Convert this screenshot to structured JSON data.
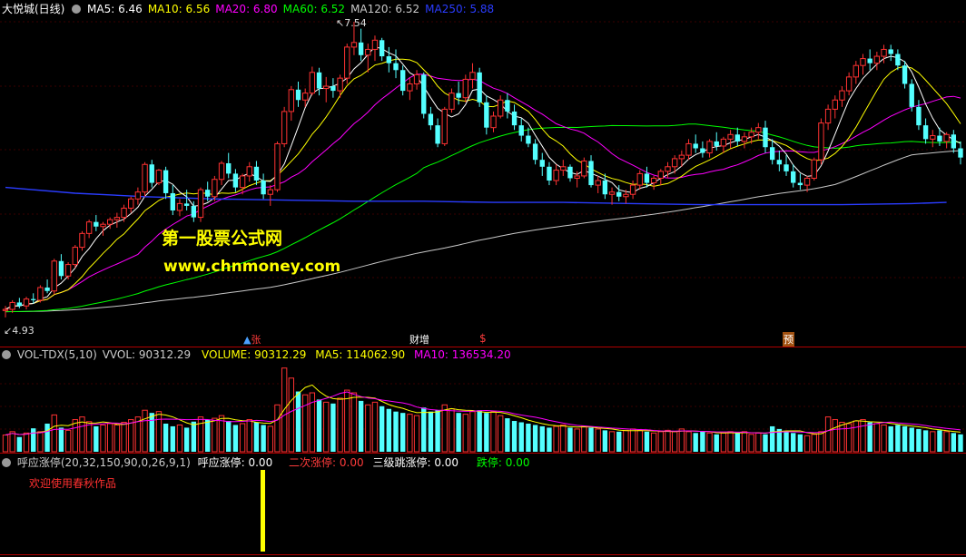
{
  "main_panel": {
    "stock_title": "大悦城(日线)",
    "indicators": [
      {
        "label": "MA5:",
        "value": "6.46",
        "color": "#ffffff"
      },
      {
        "label": "MA10:",
        "value": "6.56",
        "color": "#ffff00"
      },
      {
        "label": "MA20:",
        "value": "6.80",
        "color": "#ff00ff"
      },
      {
        "label": "MA60:",
        "value": "6.52",
        "color": "#00ff00"
      },
      {
        "label": "MA120:",
        "value": "6.52",
        "color": "#c8c8c8"
      },
      {
        "label": "MA250:",
        "value": "5.88",
        "color": "#2a3cff"
      }
    ],
    "high_label": "7.54",
    "low_label": "4.93",
    "watermark_line1": "第一股票公式网",
    "watermark_line2": "www.chnmoney.com",
    "markers": [
      {
        "text": "张",
        "color": "#ff3b3b"
      },
      {
        "text": "财增",
        "color": "#ffffff"
      },
      {
        "text": "$",
        "color": "#ff3b3b"
      },
      {
        "text": "预",
        "color": "#ffffff"
      }
    ]
  },
  "vol_panel": {
    "title": "VOL-TDX(5,10)",
    "vvol_label": "VVOL:",
    "vvol_value": "90312.29",
    "volume_label": "VOLUME:",
    "volume_value": "90312.29",
    "ma5_label": "MA5:",
    "ma5_value": "114062.90",
    "ma10_label": "MA10:",
    "ma10_value": "136534.20"
  },
  "ind_panel": {
    "title": "呼应涨停(20,32,150,90,0,26,9,1)",
    "items": [
      {
        "label": "呼应涨停:",
        "value": "0.00",
        "color": "#ffffff"
      },
      {
        "label": "二次涨停:",
        "value": "0.00",
        "color": "#ff3b3b"
      },
      {
        "label": "三级跳涨停:",
        "value": "0.00",
        "color": "#ffffff"
      },
      {
        "label": "跌停:",
        "value": "0.00",
        "color": "#00ff00"
      }
    ],
    "welcome_text": "欢迎使用春秋作品"
  },
  "chart_data": {
    "type": "candlestick",
    "price_range": [
      4.93,
      7.54
    ],
    "ma_colors": {
      "ma5": "#ffffff",
      "ma10": "#ffff00",
      "ma20": "#ff00ff",
      "ma60": "#00ff00",
      "ma120": "#c8c8c8",
      "ma250": "#2a3cff"
    },
    "candles": [
      [
        5.03,
        5.07,
        4.97,
        5.04
      ],
      [
        5.04,
        5.12,
        5.01,
        5.1
      ],
      [
        5.1,
        5.14,
        5.05,
        5.07
      ],
      [
        5.07,
        5.15,
        5.04,
        5.13
      ],
      [
        5.13,
        5.18,
        5.09,
        5.12
      ],
      [
        5.12,
        5.25,
        5.1,
        5.23
      ],
      [
        5.23,
        5.3,
        5.18,
        5.2
      ],
      [
        5.2,
        5.48,
        5.17,
        5.46
      ],
      [
        5.46,
        5.52,
        5.3,
        5.33
      ],
      [
        5.33,
        5.45,
        5.3,
        5.43
      ],
      [
        5.43,
        5.6,
        5.4,
        5.58
      ],
      [
        5.58,
        5.72,
        5.55,
        5.7
      ],
      [
        5.7,
        5.82,
        5.66,
        5.8
      ],
      [
        5.8,
        5.86,
        5.72,
        5.76
      ],
      [
        5.76,
        5.8,
        5.68,
        5.78
      ],
      [
        5.78,
        5.84,
        5.74,
        5.82
      ],
      [
        5.82,
        5.88,
        5.75,
        5.84
      ],
      [
        5.84,
        5.95,
        5.8,
        5.92
      ],
      [
        5.92,
        6.02,
        5.88,
        6.0
      ],
      [
        6.0,
        6.1,
        5.95,
        6.06
      ],
      [
        6.06,
        6.32,
        6.02,
        6.3
      ],
      [
        6.3,
        6.34,
        6.1,
        6.14
      ],
      [
        6.14,
        6.26,
        6.12,
        6.25
      ],
      [
        6.25,
        6.28,
        6.0,
        6.05
      ],
      [
        6.05,
        6.12,
        5.86,
        5.9
      ],
      [
        5.9,
        6.0,
        5.85,
        5.96
      ],
      [
        5.96,
        6.08,
        5.9,
        5.94
      ],
      [
        5.94,
        5.98,
        5.8,
        5.84
      ],
      [
        5.84,
        6.1,
        5.8,
        6.08
      ],
      [
        6.08,
        6.15,
        5.98,
        6.02
      ],
      [
        6.02,
        6.2,
        5.98,
        6.17
      ],
      [
        6.17,
        6.33,
        6.12,
        6.31
      ],
      [
        6.31,
        6.4,
        6.18,
        6.22
      ],
      [
        6.22,
        6.26,
        6.06,
        6.1
      ],
      [
        6.1,
        6.22,
        6.04,
        6.2
      ],
      [
        6.2,
        6.32,
        6.15,
        6.28
      ],
      [
        6.28,
        6.33,
        6.12,
        6.16
      ],
      [
        6.16,
        6.22,
        6.0,
        6.04
      ],
      [
        6.04,
        6.12,
        5.94,
        6.08
      ],
      [
        6.08,
        6.5,
        6.06,
        6.48
      ],
      [
        6.48,
        6.8,
        6.45,
        6.76
      ],
      [
        6.76,
        6.98,
        6.68,
        6.95
      ],
      [
        6.95,
        7.02,
        6.8,
        6.86
      ],
      [
        6.86,
        6.96,
        6.8,
        6.92
      ],
      [
        6.92,
        7.15,
        6.9,
        7.1
      ],
      [
        7.1,
        7.14,
        6.9,
        6.96
      ],
      [
        6.96,
        7.06,
        6.84,
        6.98
      ],
      [
        6.98,
        7.05,
        6.88,
        6.94
      ],
      [
        6.94,
        7.08,
        6.88,
        7.05
      ],
      [
        7.05,
        7.35,
        7.0,
        7.32
      ],
      [
        7.32,
        7.54,
        7.25,
        7.36
      ],
      [
        7.36,
        7.48,
        7.2,
        7.25
      ],
      [
        7.25,
        7.35,
        7.1,
        7.3
      ],
      [
        7.3,
        7.42,
        7.2,
        7.38
      ],
      [
        7.38,
        7.4,
        7.2,
        7.24
      ],
      [
        7.24,
        7.32,
        7.1,
        7.18
      ],
      [
        7.18,
        7.3,
        7.05,
        7.12
      ],
      [
        7.12,
        7.16,
        6.9,
        6.94
      ],
      [
        6.94,
        7.05,
        6.86,
        7.0
      ],
      [
        7.0,
        7.12,
        6.95,
        7.08
      ],
      [
        7.08,
        7.1,
        6.7,
        6.74
      ],
      [
        6.74,
        6.8,
        6.6,
        6.64
      ],
      [
        6.64,
        6.7,
        6.45,
        6.48
      ],
      [
        6.48,
        6.8,
        6.46,
        6.78
      ],
      [
        6.78,
        6.96,
        6.75,
        6.92
      ],
      [
        6.92,
        7.02,
        6.82,
        6.88
      ],
      [
        6.88,
        7.08,
        6.84,
        7.04
      ],
      [
        7.04,
        7.18,
        6.96,
        7.1
      ],
      [
        7.1,
        7.14,
        6.8,
        6.84
      ],
      [
        6.84,
        6.9,
        6.56,
        6.62
      ],
      [
        6.62,
        6.76,
        6.58,
        6.72
      ],
      [
        6.72,
        6.9,
        6.7,
        6.86
      ],
      [
        6.86,
        6.92,
        6.7,
        6.76
      ],
      [
        6.76,
        6.82,
        6.6,
        6.64
      ],
      [
        6.64,
        6.7,
        6.5,
        6.55
      ],
      [
        6.55,
        6.62,
        6.45,
        6.48
      ],
      [
        6.48,
        6.52,
        6.3,
        6.34
      ],
      [
        6.34,
        6.4,
        6.2,
        6.28
      ],
      [
        6.28,
        6.32,
        6.12,
        6.16
      ],
      [
        6.16,
        6.3,
        6.12,
        6.25
      ],
      [
        6.25,
        6.34,
        6.2,
        6.28
      ],
      [
        6.28,
        6.3,
        6.15,
        6.18
      ],
      [
        6.18,
        6.24,
        6.1,
        6.2
      ],
      [
        6.2,
        6.36,
        6.18,
        6.33
      ],
      [
        6.33,
        6.38,
        6.1,
        6.12
      ],
      [
        6.12,
        6.2,
        6.05,
        6.16
      ],
      [
        6.16,
        6.22,
        6.0,
        6.04
      ],
      [
        6.04,
        6.1,
        5.95,
        6.06
      ],
      [
        6.06,
        6.12,
        5.98,
        6.02
      ],
      [
        6.02,
        6.08,
        5.96,
        6.04
      ],
      [
        6.04,
        6.16,
        6.0,
        6.12
      ],
      [
        6.12,
        6.25,
        6.08,
        6.22
      ],
      [
        6.22,
        6.28,
        6.1,
        6.14
      ],
      [
        6.14,
        6.2,
        6.08,
        6.18
      ],
      [
        6.18,
        6.26,
        6.12,
        6.24
      ],
      [
        6.24,
        6.32,
        6.18,
        6.28
      ],
      [
        6.28,
        6.38,
        6.22,
        6.35
      ],
      [
        6.35,
        6.42,
        6.28,
        6.38
      ],
      [
        6.38,
        6.52,
        6.34,
        6.48
      ],
      [
        6.48,
        6.56,
        6.4,
        6.44
      ],
      [
        6.44,
        6.5,
        6.36,
        6.4
      ],
      [
        6.4,
        6.52,
        6.36,
        6.5
      ],
      [
        6.5,
        6.58,
        6.42,
        6.46
      ],
      [
        6.46,
        6.54,
        6.4,
        6.52
      ],
      [
        6.52,
        6.6,
        6.44,
        6.56
      ],
      [
        6.56,
        6.62,
        6.46,
        6.5
      ],
      [
        6.5,
        6.58,
        6.44,
        6.54
      ],
      [
        6.54,
        6.62,
        6.48,
        6.58
      ],
      [
        6.58,
        6.66,
        6.52,
        6.62
      ],
      [
        6.62,
        6.68,
        6.4,
        6.45
      ],
      [
        6.45,
        6.52,
        6.3,
        6.34
      ],
      [
        6.34,
        6.42,
        6.24,
        6.3
      ],
      [
        6.3,
        6.38,
        6.2,
        6.24
      ],
      [
        6.24,
        6.3,
        6.1,
        6.14
      ],
      [
        6.14,
        6.22,
        6.08,
        6.12
      ],
      [
        6.12,
        6.2,
        6.06,
        6.18
      ],
      [
        6.18,
        6.36,
        6.16,
        6.34
      ],
      [
        6.34,
        6.7,
        6.3,
        6.66
      ],
      [
        6.66,
        6.82,
        6.6,
        6.78
      ],
      [
        6.78,
        6.9,
        6.7,
        6.86
      ],
      [
        6.86,
        6.98,
        6.8,
        6.94
      ],
      [
        6.94,
        7.1,
        6.9,
        7.06
      ],
      [
        7.06,
        7.2,
        7.0,
        7.16
      ],
      [
        7.16,
        7.26,
        7.08,
        7.22
      ],
      [
        7.22,
        7.3,
        7.12,
        7.18
      ],
      [
        7.18,
        7.28,
        7.12,
        7.24
      ],
      [
        7.24,
        7.34,
        7.18,
        7.3
      ],
      [
        7.3,
        7.34,
        7.2,
        7.26
      ],
      [
        7.26,
        7.3,
        7.12,
        7.16
      ],
      [
        7.16,
        7.2,
        6.96,
        7.0
      ],
      [
        7.0,
        7.04,
        6.76,
        6.8
      ],
      [
        6.8,
        6.86,
        6.6,
        6.64
      ],
      [
        6.64,
        6.7,
        6.48,
        6.52
      ],
      [
        6.52,
        6.6,
        6.45,
        6.55
      ],
      [
        6.55,
        6.62,
        6.46,
        6.5
      ],
      [
        6.5,
        6.58,
        6.44,
        6.56
      ],
      [
        6.56,
        6.6,
        6.4,
        6.44
      ],
      [
        6.44,
        6.5,
        6.3,
        6.36
      ]
    ],
    "ma250": [
      [
        0,
        6.1
      ],
      [
        10,
        6.05
      ],
      [
        20,
        6.02
      ],
      [
        30,
        6.0
      ],
      [
        40,
        5.99
      ],
      [
        50,
        5.98
      ],
      [
        60,
        5.98
      ],
      [
        70,
        5.97
      ],
      [
        80,
        5.97
      ],
      [
        90,
        5.96
      ],
      [
        100,
        5.95
      ],
      [
        110,
        5.95
      ],
      [
        120,
        5.95
      ],
      [
        130,
        5.96
      ],
      [
        135,
        5.97
      ]
    ],
    "volumes": [
      25,
      30,
      22,
      28,
      35,
      30,
      42,
      55,
      36,
      32,
      48,
      52,
      45,
      38,
      40,
      42,
      40,
      44,
      48,
      52,
      62,
      58,
      60,
      42,
      38,
      40,
      36,
      45,
      52,
      48,
      50,
      54,
      46,
      40,
      42,
      48,
      44,
      40,
      38,
      70,
      125,
      110,
      90,
      85,
      88,
      78,
      74,
      72,
      80,
      92,
      88,
      76,
      70,
      74,
      68,
      64,
      60,
      58,
      56,
      54,
      66,
      60,
      62,
      70,
      64,
      58,
      56,
      60,
      62,
      58,
      60,
      54,
      50,
      46,
      44,
      42,
      40,
      38,
      36,
      38,
      40,
      36,
      34,
      38,
      36,
      34,
      32,
      30,
      30,
      32,
      34,
      32,
      30,
      28,
      30,
      32,
      30,
      34,
      30,
      28,
      30,
      28,
      26,
      28,
      30,
      28,
      30,
      26,
      28,
      26,
      38,
      34,
      30,
      28,
      26,
      24,
      26,
      30,
      52,
      48,
      44,
      42,
      46,
      48,
      44,
      42,
      40,
      38,
      40,
      38,
      36,
      34,
      32,
      30,
      32,
      30,
      28,
      26
    ]
  }
}
